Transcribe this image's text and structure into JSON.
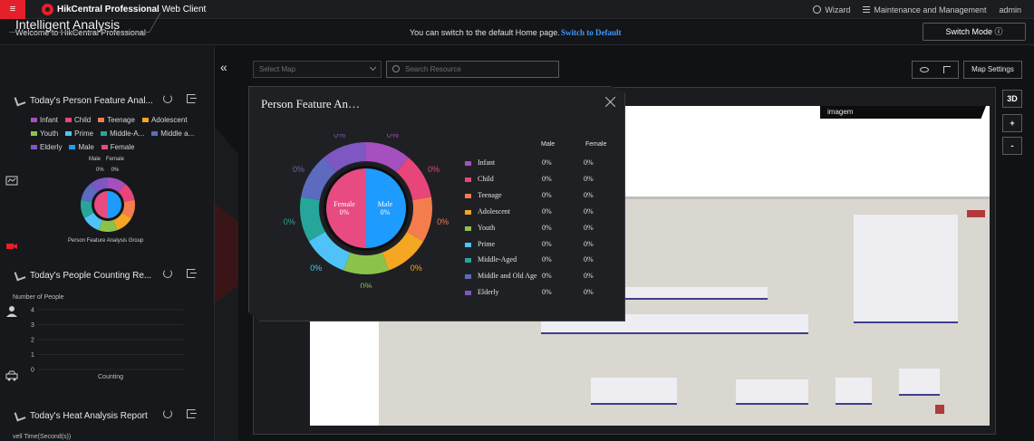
{
  "topbar": {
    "menu_icon": "hamburger-icon",
    "brand_bold": "HikCentral Professional",
    "brand_light": " Web Client",
    "wizard_label": "Wizard",
    "maintenance_label": "Maintenance and Management",
    "user_label": "admin"
  },
  "welcome_bar": {
    "welcome_text": "Welcome to HikCentral Professional",
    "switch_note": "You can switch to the default Home page.",
    "switch_link": "Switch to Default",
    "switch_mode_label": "Switch Mode ⓘ"
  },
  "left_panel": {
    "title": "Intelligent Analysis",
    "collapse_glyph": "«",
    "person_card": {
      "title": "Today's Person Feature Anal...",
      "legend": [
        {
          "label": "Infant",
          "color": "#a64fbf"
        },
        {
          "label": "Child",
          "color": "#e8457a"
        },
        {
          "label": "Teenage",
          "color": "#f47d4e"
        },
        {
          "label": "Adolescent",
          "color": "#f5a623"
        },
        {
          "label": "Youth",
          "color": "#8bc34a"
        },
        {
          "label": "Prime",
          "color": "#4fc3f7"
        },
        {
          "label": "Middle-A...",
          "color": "#26a69a"
        },
        {
          "label": "Middle a...",
          "color": "#5c6bc0"
        },
        {
          "label": "Elderly",
          "color": "#7e57c2"
        },
        {
          "label": "Male",
          "color": "#1e9bff"
        },
        {
          "label": "Female",
          "color": "#e84a82"
        }
      ],
      "mini_male_head": "Male",
      "mini_female_head": "Female",
      "mini_male_val": "0%",
      "mini_female_val": "0%",
      "caption": "Person Feature Analysis Group"
    },
    "counting_card": {
      "title": "Today's People Counting Re...",
      "ylabel": "Number of People",
      "xlabel": "Counting",
      "ticks": [
        "4",
        "3",
        "2",
        "1",
        "0"
      ]
    },
    "heat_card": {
      "title": "Today's Heat Analysis Report",
      "ylabel": "vell Time(Second(s))"
    }
  },
  "toolbar": {
    "map_select_placeholder": "Select Map",
    "search_placeholder": "Search Resource",
    "map_settings_label": "Map Settings"
  },
  "map": {
    "tab_label": "imagem",
    "ctrl_3d": "3D",
    "zoom_in": "+",
    "zoom_out": "-"
  },
  "popup": {
    "title": "Person Feature An…",
    "col_male": "Male",
    "col_female": "Female",
    "inner_female_label": "Female",
    "inner_female_val": "0%",
    "inner_male_label": "Male",
    "inner_male_val": "0%",
    "rows": [
      {
        "name": "Infant",
        "color": "#a64fbf",
        "male": "0%",
        "female": "0%"
      },
      {
        "name": "Child",
        "color": "#e8457a",
        "male": "0%",
        "female": "0%"
      },
      {
        "name": "Teenage",
        "color": "#f47d4e",
        "male": "0%",
        "female": "0%"
      },
      {
        "name": "Adolescent",
        "color": "#f5a623",
        "male": "0%",
        "female": "0%"
      },
      {
        "name": "Youth",
        "color": "#8bc34a",
        "male": "0%",
        "female": "0%"
      },
      {
        "name": "Prime",
        "color": "#4fc3f7",
        "male": "0%",
        "female": "0%"
      },
      {
        "name": "Middle-Aged",
        "color": "#26a69a",
        "male": "0%",
        "female": "0%"
      },
      {
        "name": "Middle and Old Age",
        "color": "#5c6bc0",
        "male": "0%",
        "female": "0%"
      },
      {
        "name": "Elderly",
        "color": "#7e57c2",
        "male": "0%",
        "female": "0%"
      }
    ],
    "ring_values": [
      "0%",
      "0%",
      "0%",
      "0%",
      "0%",
      "0%",
      "0%",
      "0%",
      "0%"
    ]
  },
  "colors": {
    "accent_red": "#e5202b",
    "link_blue": "#3c9bff",
    "male_blue": "#1e9bff",
    "female_pink": "#e84a82"
  }
}
